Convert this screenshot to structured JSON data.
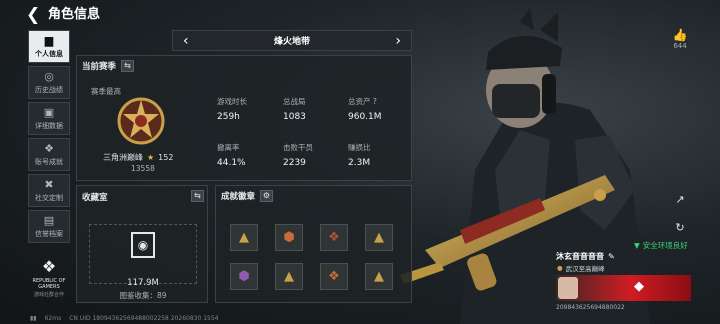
{
  "header": {
    "title": "角色信息"
  },
  "sidebar": {
    "items": [
      {
        "label": "个人信息",
        "icon": "bar-chart-icon"
      },
      {
        "label": "历史战绩",
        "icon": "target-icon"
      },
      {
        "label": "详细数据",
        "icon": "folder-icon"
      },
      {
        "label": "账号成就",
        "icon": "medal-icon"
      },
      {
        "label": "社交定制",
        "icon": "tools-icon"
      },
      {
        "label": "信誉档案",
        "icon": "document-icon"
      }
    ],
    "logo_line1": "REPUBLIC OF",
    "logo_line2": "GAMERS",
    "logo_sub": "游戏社群合作"
  },
  "season": {
    "name": "烽火地带"
  },
  "current_season": {
    "title": "当前赛季",
    "best_label": "赛季最高",
    "rank_name": "三角洲巅峰",
    "rank_stars": "152",
    "rank_score": "13558",
    "stats": [
      {
        "label": "游戏时长",
        "value": "259h"
      },
      {
        "label": "总战局",
        "value": "1083"
      },
      {
        "label": "总资产",
        "value": "960.1M"
      },
      {
        "label": "撤离率",
        "value": "44.1%"
      },
      {
        "label": "击败干员",
        "value": "2239"
      },
      {
        "label": "赚损比",
        "value": "2.3M"
      }
    ]
  },
  "collection": {
    "title": "收藏室",
    "value": "117.9M",
    "count_text": "图鉴收集：89"
  },
  "achievements": {
    "title": "成就徽章"
  },
  "right": {
    "like_count": "644"
  },
  "player": {
    "name": "沐玄音音音音",
    "sub": "武汉至高巅峰",
    "env_text": "安全环境良好",
    "card_id": "209843625694880022"
  },
  "footer": {
    "fps": "62ms",
    "uid": "CN UID 18094362569488002258 20260830 1554"
  },
  "colors": {
    "gold": "#c9a04a",
    "env_green": "#3ed07a",
    "rog_red": "#d01c24"
  }
}
